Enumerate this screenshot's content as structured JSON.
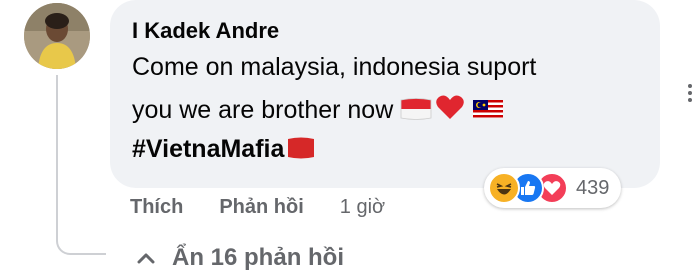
{
  "comment": {
    "author": "I Kadek Andre",
    "text_line1": "Come on malaysia, indonesia suport",
    "text_line2": "you we are brother now",
    "hashtag": "#VietnaMafia"
  },
  "reactions": {
    "types": [
      "haha",
      "like",
      "love"
    ],
    "count": "439"
  },
  "actions": {
    "like": "Thích",
    "reply": "Phản hồi",
    "time": "1 giờ"
  },
  "replies": {
    "toggle_label": "Ẩn 16 phản hồi"
  },
  "colors": {
    "bubble": "#f0f2f5",
    "like_blue": "#1877f2",
    "love_red": "#f33e58",
    "haha_yellow": "#f7b125",
    "meta_gray": "#65676b"
  },
  "icons": [
    "avatar",
    "indonesia-flag-icon",
    "heart-icon",
    "malaysia-flag-icon",
    "red-flag-icon",
    "haha-icon",
    "like-icon",
    "love-icon",
    "more-options-icon",
    "chevron-up-icon"
  ]
}
